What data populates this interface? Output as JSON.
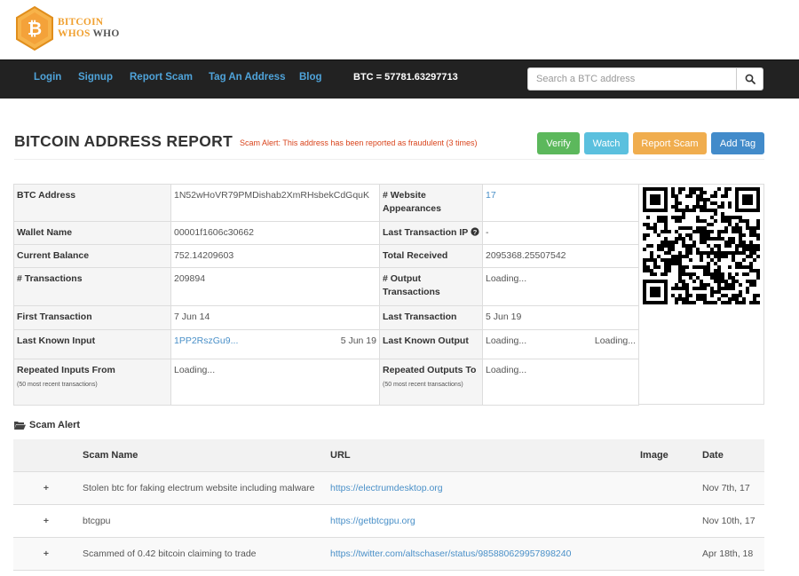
{
  "brand": {
    "line1": "Bitcoin",
    "line2a": "Whos",
    "line2b": "Who",
    "logo_icon": "bitcoin-hexagon-logo",
    "accent": "#f0a030"
  },
  "nav": {
    "links": [
      "Login",
      "Signup",
      "Report Scam",
      "Tag An Address",
      "Blog"
    ],
    "btc_price": "BTC = 57781.63297713",
    "search_placeholder": "Search a BTC address",
    "search_icon": "magnifier-icon"
  },
  "report": {
    "title": "BITCOIN ADDRESS REPORT",
    "scam_alert": "Scam Alert: This address has been reported as fraudulent (3 times)",
    "buttons": {
      "verify": "Verify",
      "watch": "Watch",
      "report": "Report Scam",
      "tag": "Add Tag"
    },
    "colors": {
      "verify": "#5cb85c",
      "watch": "#5bc0de",
      "report": "#f0ad4e",
      "tag": "#428bca",
      "alert": "#d9441c"
    }
  },
  "info": {
    "btc_address_label": "BTC Address",
    "btc_address": "1N52wHoVR79PMDishab2XmRHsbekCdGquK",
    "website_appearances_label": "# Website Appearances",
    "website_appearances": "17",
    "wallet_name_label": "Wallet Name",
    "wallet_name": "00001f1606c30662",
    "last_tx_ip_label": "Last Transaction IP",
    "last_tx_ip": "-",
    "current_balance_label": "Current Balance",
    "current_balance": "752.14209603",
    "total_received_label": "Total Received",
    "total_received": "2095368.25507542",
    "num_tx_label": "# Transactions",
    "num_tx": "209894",
    "output_tx_label": "# Output Transactions",
    "output_tx": "Loading...",
    "first_tx_label": "First Transaction",
    "first_tx": "7 Jun 14",
    "last_tx_label": "Last Transaction",
    "last_tx": "5 Jun 19",
    "last_input_label": "Last Known Input",
    "last_input_addr": "1PP2RszGu9...",
    "last_input_date": "5 Jun 19",
    "last_output_label": "Last Known Output",
    "last_output_addr": "Loading...",
    "last_output_date": "Loading...",
    "rep_inputs_label": "Repeated Inputs From",
    "rep_inputs_sub": "(50 most recent transactions)",
    "rep_inputs": "Loading...",
    "rep_outputs_label": "Repeated Outputs To",
    "rep_outputs_sub": "(50 most recent transactions)",
    "rep_outputs": "Loading..."
  },
  "scams": {
    "heading": "Scam Alert",
    "columns": [
      "",
      "Scam Name",
      "URL",
      "Image",
      "Date"
    ],
    "rows": [
      {
        "expand": "+",
        "name": "Stolen btc for faking electrum website including malware",
        "url": "https://electrumdesktop.org",
        "image": "",
        "date": "Nov 7th, 17"
      },
      {
        "expand": "+",
        "name": "btcgpu",
        "url": "https://getbtcgpu.org",
        "image": "",
        "date": "Nov 10th, 17"
      },
      {
        "expand": "+",
        "name": "Scammed of 0.42 bitcoin claiming to trade",
        "url": "https://twitter.com/altschaser/status/985880629957898240",
        "image": "",
        "date": "Apr 18th, 18"
      }
    ]
  }
}
